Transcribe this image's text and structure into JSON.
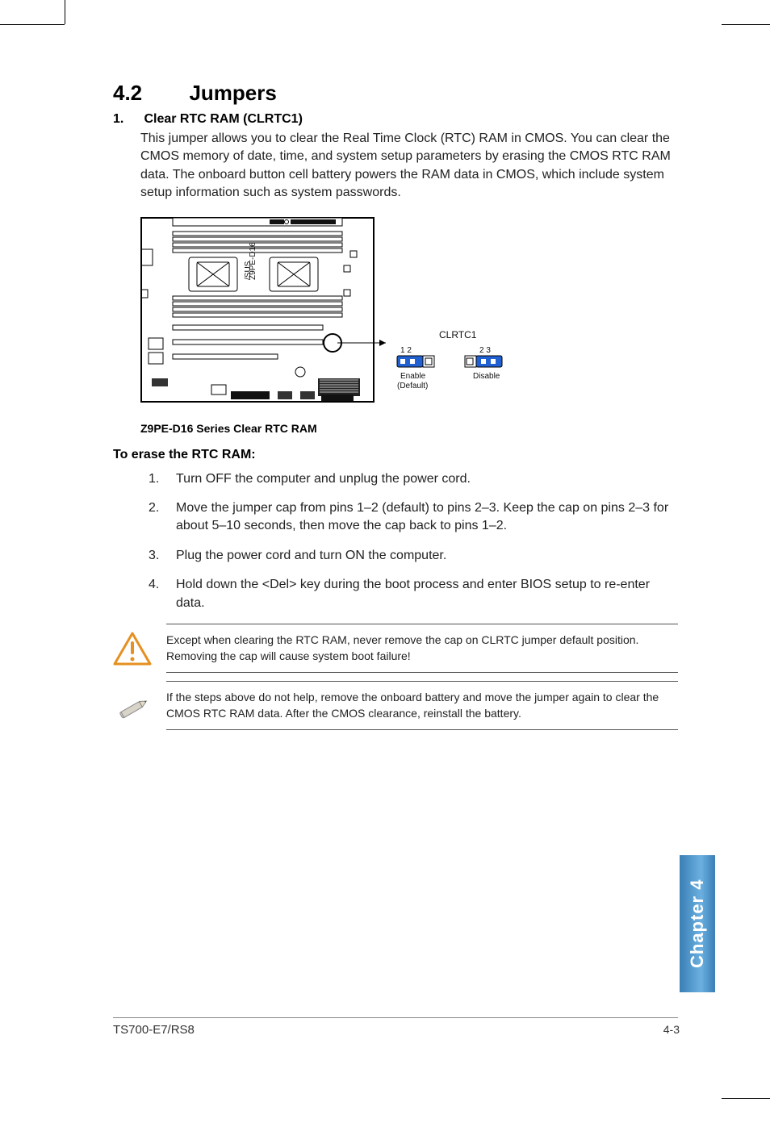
{
  "section": {
    "number": "4.2",
    "title": "Jumpers"
  },
  "item1": {
    "num": "1.",
    "heading": "Clear RTC RAM (CLRTC1)",
    "body": "This jumper allows you to clear the  Real Time Clock (RTC) RAM in CMOS. You can clear the CMOS memory of date, time, and system setup parameters by erasing the CMOS RTC RAM data. The onboard button cell battery powers the RAM data in CMOS, which include system setup information such as system passwords."
  },
  "diagram": {
    "board_model_top": "/SUS",
    "board_model_bottom": "Z9PE-D16",
    "caption": "Z9PE-D16 Series Clear RTC RAM",
    "header_label": "CLRTC1",
    "enable": {
      "pins": "1   2",
      "label1": "Enable",
      "label2": "(Default)"
    },
    "disable": {
      "pins": "2   3",
      "label1": "Disable"
    }
  },
  "erase": {
    "heading": "To erase the RTC RAM:",
    "steps": [
      {
        "n": "1.",
        "t": "Turn OFF the computer and unplug the power cord."
      },
      {
        "n": "2.",
        "t": "Move the jumper cap from pins 1–2 (default) to pins 2–3. Keep the cap on pins 2–3 for about 5–10 seconds, then move the cap back to pins 1–2."
      },
      {
        "n": "3.",
        "t": "Plug the power cord and turn ON the computer."
      },
      {
        "n": "4.",
        "t": "Hold down the <Del> key during the boot process and enter BIOS setup to re-enter data."
      }
    ]
  },
  "caution": "Except when clearing the RTC RAM, never remove the cap on CLRTC jumper default position. Removing the cap will cause system boot failure!",
  "note": "If the steps above do not help, remove the onboard battery and move the jumper again to clear the CMOS RTC RAM data. After the CMOS clearance, reinstall the battery.",
  "side_tab": "Chapter 4",
  "footer": {
    "left": "TS700-E7/RS8",
    "right": "4-3"
  }
}
